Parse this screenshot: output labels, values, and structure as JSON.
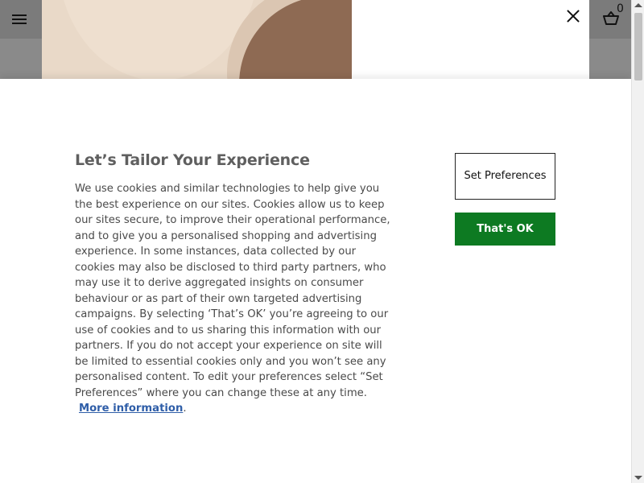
{
  "header": {
    "basket_count": "0"
  },
  "cookie": {
    "title": "Let’s Tailor Your Experience",
    "body": "We use cookies and similar technologies to help give you the best experience on our sites. Cookies allow us to keep our sites secure, to improve their operational performance, and to give you a personalised shopping and advertising experience. In some instances, data collected by our cookies may also be disclosed to third party partners, who may use it to derive aggregated insights on consumer behaviour or as part of their own targeted advertising campaigns. By selecting ‘That’s OK’ you’re agreeing to our use of cookies and to us sharing this information with our partners. If you do not accept your experience on site will be limited to essential cookies only and you won’t see any personalised content. To edit your preferences select “Set Preferences” where you can change these at any time.",
    "more_info": "More information",
    "more_info_suffix": ".",
    "set_preferences": "Set Preferences",
    "thats_ok": "That's OK"
  },
  "colors": {
    "accept_button": "#0d7a22",
    "link": "#2f5ea8"
  },
  "icons": {
    "menu": "hamburger-menu-icon",
    "close": "close-icon",
    "basket": "basket-icon"
  }
}
